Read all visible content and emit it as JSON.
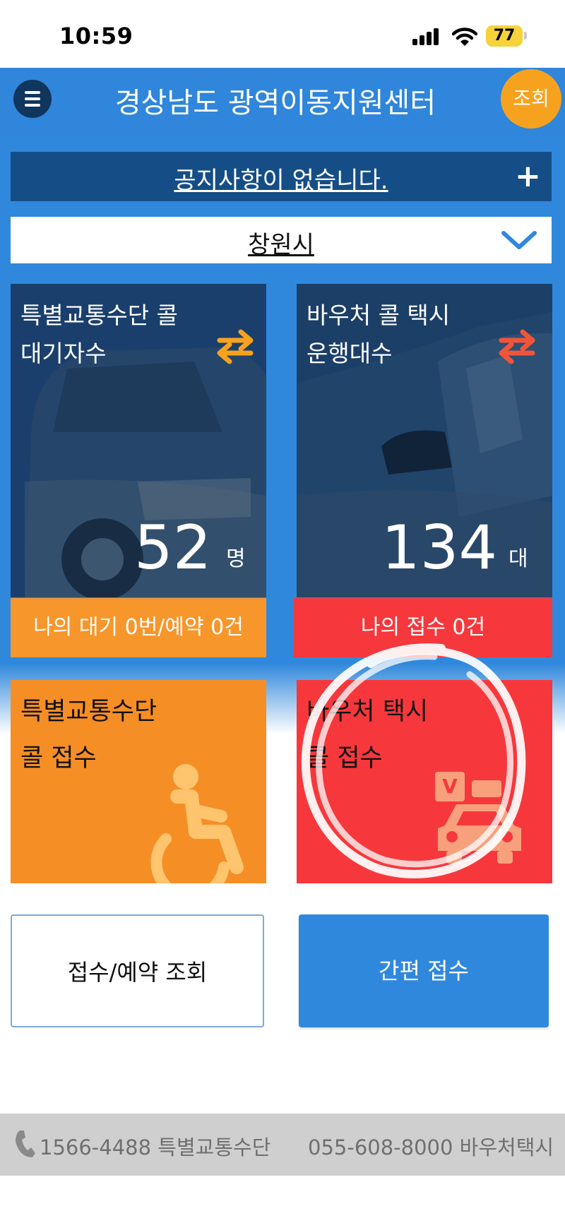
{
  "status_bar": {
    "time": "10:59",
    "battery": "77"
  },
  "header": {
    "title": "경상남도 광역이동지원센터",
    "search_label": "조회"
  },
  "notice": {
    "text": "공지사항이 없습니다."
  },
  "region": {
    "selected": "창원시"
  },
  "stats": {
    "special_wait": {
      "label_line1": "특별교통수단 콜",
      "label_line2": "대기자수",
      "value": "52",
      "unit": "명",
      "my_status": "나의 대기 0번/예약 0건"
    },
    "voucher_taxi": {
      "label_line1": "바우처 콜 택시",
      "label_line2": "운행대수",
      "value": "134",
      "unit": "대",
      "my_status": "나의 접수 0건"
    }
  },
  "call_tiles": {
    "special": {
      "line1": "특별교통수단",
      "line2": "콜 접수"
    },
    "voucher": {
      "line1": "바우처 택시",
      "line2": "콜 접수",
      "badge": "V"
    }
  },
  "buttons": {
    "lookup": "접수/예약 조회",
    "quick": "간편 접수"
  },
  "footer": {
    "left": "1566-4488 특별교통수단",
    "right": "055-608-8000 바우처택시"
  },
  "colors": {
    "primary_blue": "#3088dc",
    "dark_blue": "#154e86",
    "orange": "#f68e26",
    "red": "#f6383c",
    "search_orange": "#f7a21e"
  }
}
